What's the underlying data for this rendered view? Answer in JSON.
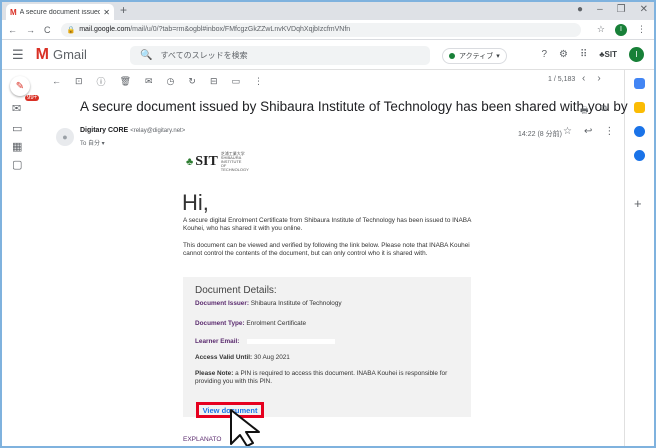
{
  "browser": {
    "tab_title": "A secure document issued by Shi",
    "tab_icon": "gmail-m-icon",
    "url_host": "mail.google.com",
    "url_path": "/mail/u/0/?tab=rm&ogbl#inbox/FMfcgzGkZZwLnvKVDqhXqjbIzcfmVNfn",
    "profile_initial": "I"
  },
  "gmail": {
    "app_name": "Gmail",
    "search_placeholder": "すべてのスレッドを検索",
    "status_label": "アクティブ",
    "org_chip": "SIT",
    "avatar_initial": "I",
    "unread_badge": "99+",
    "count_label": "1 / 5,183"
  },
  "email": {
    "subject": "A secure document issued by Shibaura Institute of Technology has been shared with you by",
    "sender_name": "Digitary CORE",
    "sender_email": "<relay@digitary.net>",
    "to_label": "To 自分 ▾",
    "time": "14:22 (8 分前)"
  },
  "body": {
    "logo_text": "SIT",
    "logo_sub": "芝浦工業大学 SHIBAURA INSTITUTE OF TECHNOLOGY",
    "greeting": "Hi,",
    "para1": "A secure digital Enrolment Certificate from Shibaura Institute of Technology has been issued to INABA Kouhei, who has shared it with you online.",
    "para2": "This document can be viewed and verified by following the link below. Please note that INABA Kouhei cannot control the contents of the document, but can only control who it is shared with.",
    "details_heading": "Document Details:",
    "issuer_label": "Document Issuer:",
    "issuer_value": "Shibaura Institute of Technology",
    "type_label": "Document Type:",
    "type_value": "Enrolment Certificate",
    "learner_label": "Learner Email:",
    "access_label": "Access Valid Until:",
    "access_value": "30 Aug 2021",
    "note_label": "Please Note:",
    "note_text": "a PIN is required to access this document. INABA Kouhei is responsible for providing you with this PIN.",
    "view_button": "View document",
    "explanation": "EXPLANATO"
  },
  "colors": {
    "gmail_red": "#d93025",
    "link_blue": "#1a73e8",
    "highlight_red": "#e6001f",
    "label_purple": "#5a2a6e"
  }
}
